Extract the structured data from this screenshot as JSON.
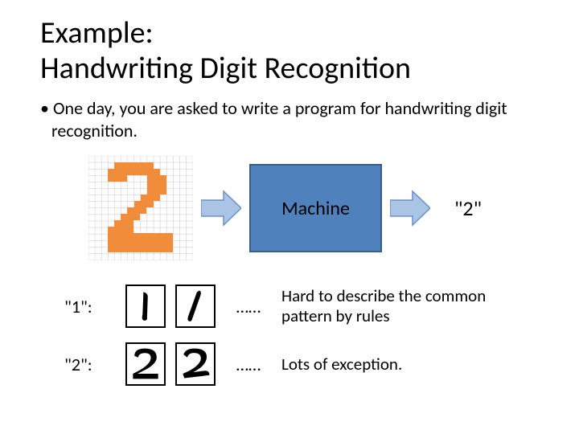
{
  "title_line1": "Example:",
  "title_line2": "Handwriting Digit Recognition",
  "bullet_text": "One day, you are asked to write a program for handwriting digit recognition.",
  "machine_label": "Machine",
  "output_label": "\"2\"",
  "examples": [
    {
      "label": "\"1\":",
      "dots": "……",
      "note": "Hard to describe the common pattern by rules"
    },
    {
      "label": "\"2\":",
      "dots": "……",
      "note": "Lots of exception."
    }
  ],
  "colors": {
    "digit_orange": "#f08c3a",
    "grid_line": "#c8c8c8",
    "box_fill": "#4f81bd",
    "box_border": "#385d8a",
    "arrow_fill": "#a9c4e5",
    "arrow_border": "#6a8fc7"
  }
}
